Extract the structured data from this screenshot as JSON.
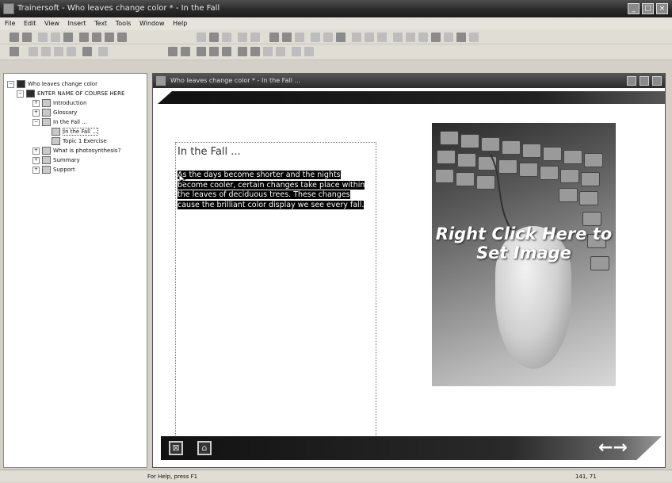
{
  "app": {
    "title": "Trainersoft - Who leaves change color * - In the Fall",
    "window_buttons": [
      "_",
      "□",
      "×"
    ]
  },
  "menu": [
    "File",
    "Edit",
    "View",
    "Insert",
    "Text",
    "Tools",
    "Window",
    "Help"
  ],
  "tree": {
    "items": [
      {
        "label": "Who leaves change color",
        "icon": "book-icon"
      },
      {
        "label": "ENTER NAME OF COURSE HERE",
        "icon": "course-icon"
      },
      {
        "label": "Introduction",
        "icon": "chapter-icon"
      },
      {
        "label": "Glossary",
        "icon": "chapter-icon"
      },
      {
        "label": "In the Fall ...",
        "icon": "chapter-icon"
      },
      {
        "label": "In the Fall ...",
        "icon": "page-icon"
      },
      {
        "label": "Topic 1 Exercise",
        "icon": "page-icon"
      },
      {
        "label": "What is photosynthesis?",
        "icon": "chapter-icon"
      },
      {
        "label": "Summary",
        "icon": "chapter-icon"
      },
      {
        "label": "Support",
        "icon": "chapter-icon"
      }
    ]
  },
  "document": {
    "title": "Who leaves change color * - In the Fall ...",
    "page_heading": "In the Fall ...",
    "body_text": "As the days become shorter and the nights become cooler, certain changes take place within the leaves of deciduous trees. These changes cause the brilliant color display we see every fall.",
    "image_caption": "Right Click Here to Set Image",
    "nav_arrows": "←→"
  },
  "status": {
    "help_text": "For Help, press F1",
    "coords": "141, 71"
  }
}
